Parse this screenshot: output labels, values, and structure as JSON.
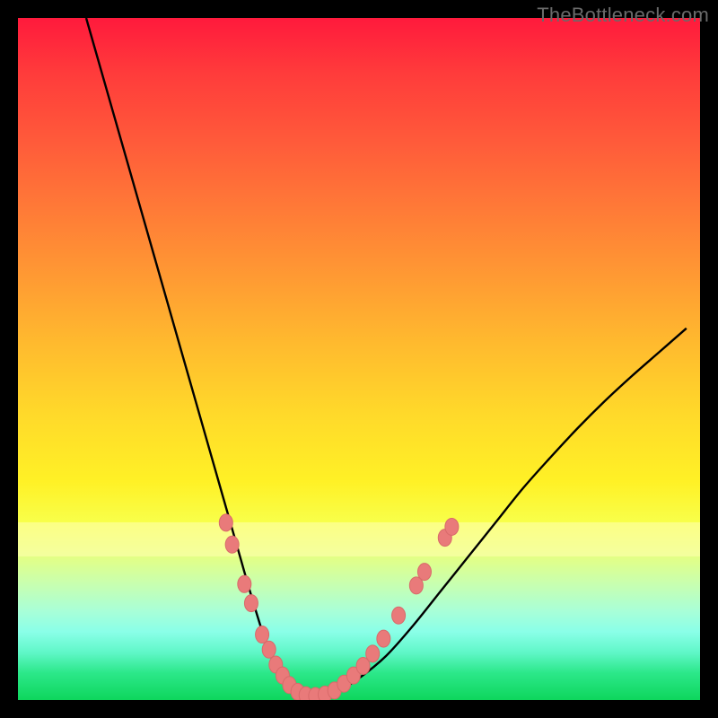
{
  "watermark": "TheBottleneck.com",
  "colors": {
    "frame": "#000000",
    "curve": "#000000",
    "marker_fill": "#e97a7a",
    "marker_stroke": "#d86a6a"
  },
  "chart_data": {
    "type": "line",
    "title": "",
    "xlabel": "",
    "ylabel": "",
    "xlim": [
      0,
      100
    ],
    "ylim": [
      0,
      100
    ],
    "series": [
      {
        "name": "bottleneck-curve",
        "x": [
          10,
          12,
          14,
          16,
          18,
          20,
          22,
          24,
          26,
          28,
          30,
          32,
          34,
          36,
          37.5,
          39,
          40.5,
          42,
          44,
          47,
          50,
          54,
          58,
          62,
          66,
          70,
          74,
          78,
          82,
          86,
          90,
          94,
          98
        ],
        "y": [
          100,
          93,
          86,
          79,
          72,
          65,
          58,
          51,
          44,
          37,
          30,
          23,
          16,
          9.5,
          5.5,
          3,
          1.4,
          0.6,
          0.6,
          1.4,
          3.2,
          6.5,
          11,
          16,
          21,
          26,
          31,
          35.5,
          39.8,
          43.8,
          47.5,
          51,
          54.5
        ]
      }
    ],
    "markers": {
      "name": "highlighted-points",
      "points": [
        {
          "x": 30.5,
          "y": 26
        },
        {
          "x": 31.4,
          "y": 22.8
        },
        {
          "x": 33.2,
          "y": 17
        },
        {
          "x": 34.2,
          "y": 14.2
        },
        {
          "x": 35.8,
          "y": 9.6
        },
        {
          "x": 36.8,
          "y": 7.4
        },
        {
          "x": 37.8,
          "y": 5.2
        },
        {
          "x": 38.8,
          "y": 3.6
        },
        {
          "x": 39.8,
          "y": 2.2
        },
        {
          "x": 41.0,
          "y": 1.2
        },
        {
          "x": 42.2,
          "y": 0.7
        },
        {
          "x": 43.6,
          "y": 0.6
        },
        {
          "x": 45.0,
          "y": 0.8
        },
        {
          "x": 46.4,
          "y": 1.4
        },
        {
          "x": 47.8,
          "y": 2.4
        },
        {
          "x": 49.2,
          "y": 3.6
        },
        {
          "x": 50.6,
          "y": 5.0
        },
        {
          "x": 52.0,
          "y": 6.8
        },
        {
          "x": 53.6,
          "y": 9.0
        },
        {
          "x": 55.8,
          "y": 12.4
        },
        {
          "x": 58.4,
          "y": 16.8
        },
        {
          "x": 59.6,
          "y": 18.8
        },
        {
          "x": 62.6,
          "y": 23.8
        },
        {
          "x": 63.6,
          "y": 25.4
        }
      ]
    },
    "bands": [
      {
        "name": "pale-yellow-band",
        "y_from": 21,
        "y_to": 26
      }
    ]
  }
}
